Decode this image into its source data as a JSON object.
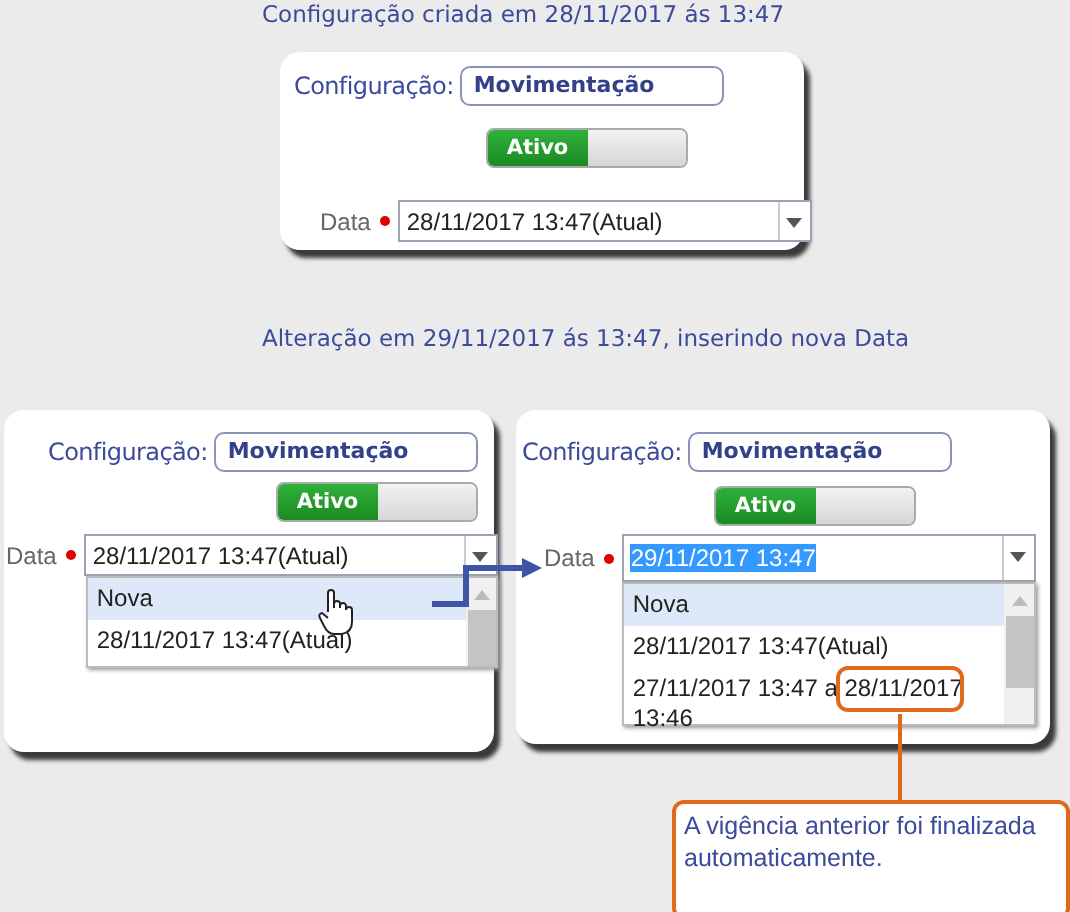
{
  "sections": [
    {
      "title": "Configuração criada em 28/11/2017 ás 13:47",
      "panels": [
        {
          "config_label": "Configuração:",
          "config_value": "Movimentação",
          "toggle": {
            "label": "Ativo",
            "on": true
          },
          "date_label": "Data",
          "required": true,
          "date_value": "28/11/2017 13:47(Atual)",
          "date_value_selected": false
        }
      ]
    },
    {
      "title": "Alteração em 29/11/2017 ás 13:47, inserindo nova Data",
      "panels": [
        {
          "config_label": "Configuração:",
          "config_value": "Movimentação",
          "toggle": {
            "label": "Ativo",
            "on": true
          },
          "date_label": "Data",
          "required": true,
          "date_value": "28/11/2017 13:47(Atual)",
          "date_value_selected": false,
          "dropdown": {
            "expanded": true,
            "items": [
              {
                "label": "Nova",
                "selected": true
              },
              {
                "label": "28/11/2017 13:47(Atual)",
                "selected": false
              }
            ]
          }
        },
        {
          "config_label": "Configuração:",
          "config_value": "Movimentação",
          "toggle": {
            "label": "Ativo",
            "on": true
          },
          "date_label": "Data",
          "required": true,
          "date_value": "29/11/2017 13:47",
          "date_value_selected": true,
          "dropdown": {
            "expanded": true,
            "items": [
              {
                "label": "Nova",
                "selected": true
              },
              {
                "label": "28/11/2017 13:47(Atual)",
                "selected": false
              },
              {
                "label": "27/11/2017 13:47 a 28/11/2017 13:46",
                "selected": false
              }
            ]
          }
        }
      ]
    }
  ],
  "callout": {
    "text": "A vigência anterior foi finalizada automaticamente."
  }
}
